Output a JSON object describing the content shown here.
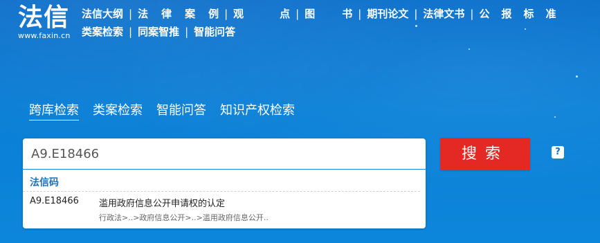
{
  "logo": {
    "main": "法信",
    "url": "www.faxin.cn"
  },
  "topnav": {
    "row1": [
      "法信大纲",
      "法律案例",
      "观点",
      "图书",
      "期刊论文",
      "法律文书",
      "公报标准"
    ],
    "row2": [
      "类案检索",
      "同案智推",
      "智能问答"
    ]
  },
  "search_tabs": [
    "跨库检索",
    "类案检索",
    "智能问答",
    "知识产权检索"
  ],
  "search": {
    "value": "A9.E18466",
    "button_label": "搜索"
  },
  "suggest": {
    "section_title": "法信码",
    "items": [
      {
        "code": "A9.E18466",
        "title": "滥用政府信息公开申请权的认定",
        "path": "行政法>..>政府信息公开>..>滥用政府信息公开.."
      }
    ]
  },
  "help": {
    "label": "?"
  }
}
